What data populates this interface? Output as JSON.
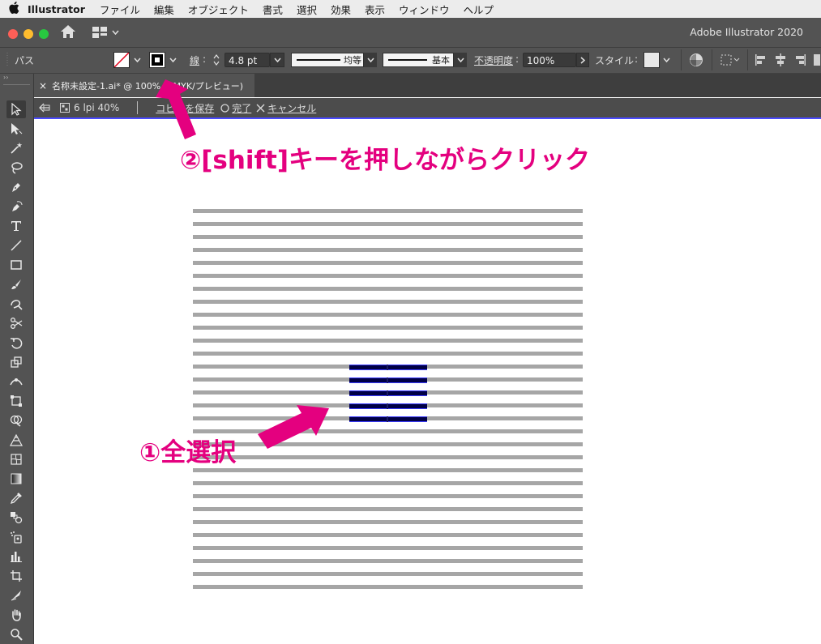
{
  "menubar": {
    "app_name": "Illustrator",
    "items": [
      "ファイル",
      "編集",
      "オブジェクト",
      "書式",
      "選択",
      "効果",
      "表示",
      "ウィンドウ",
      "ヘルプ"
    ]
  },
  "window": {
    "app_title": "Adobe Illustrator 2020"
  },
  "controlbar": {
    "object_type": "パス",
    "stroke_label": "線",
    "stroke_weight": "4.8 pt",
    "profile_label": "均等",
    "brush_label": "基本",
    "opacity_label": "不透明度",
    "opacity_value": "100%",
    "style_label": "スタイル"
  },
  "tab": {
    "title": "名称未設定-1.ai* @ 100% (CMYK/プレビュー)"
  },
  "isolation": {
    "pattern_name": "6 lpi 40%",
    "save_label": "コピーを保存",
    "done_label": "完了",
    "cancel_label": "キャンセル"
  },
  "annotations": {
    "step1": "①全選択",
    "step2": "②[shift]キーを押しながらクリック"
  },
  "colors": {
    "annotation": "#e4007f",
    "panel": "#535353",
    "line_gray": "#a6a6a6",
    "selection": "#3b3bff"
  },
  "canvas": {
    "line_count": 30,
    "selected_line_count": 5
  }
}
